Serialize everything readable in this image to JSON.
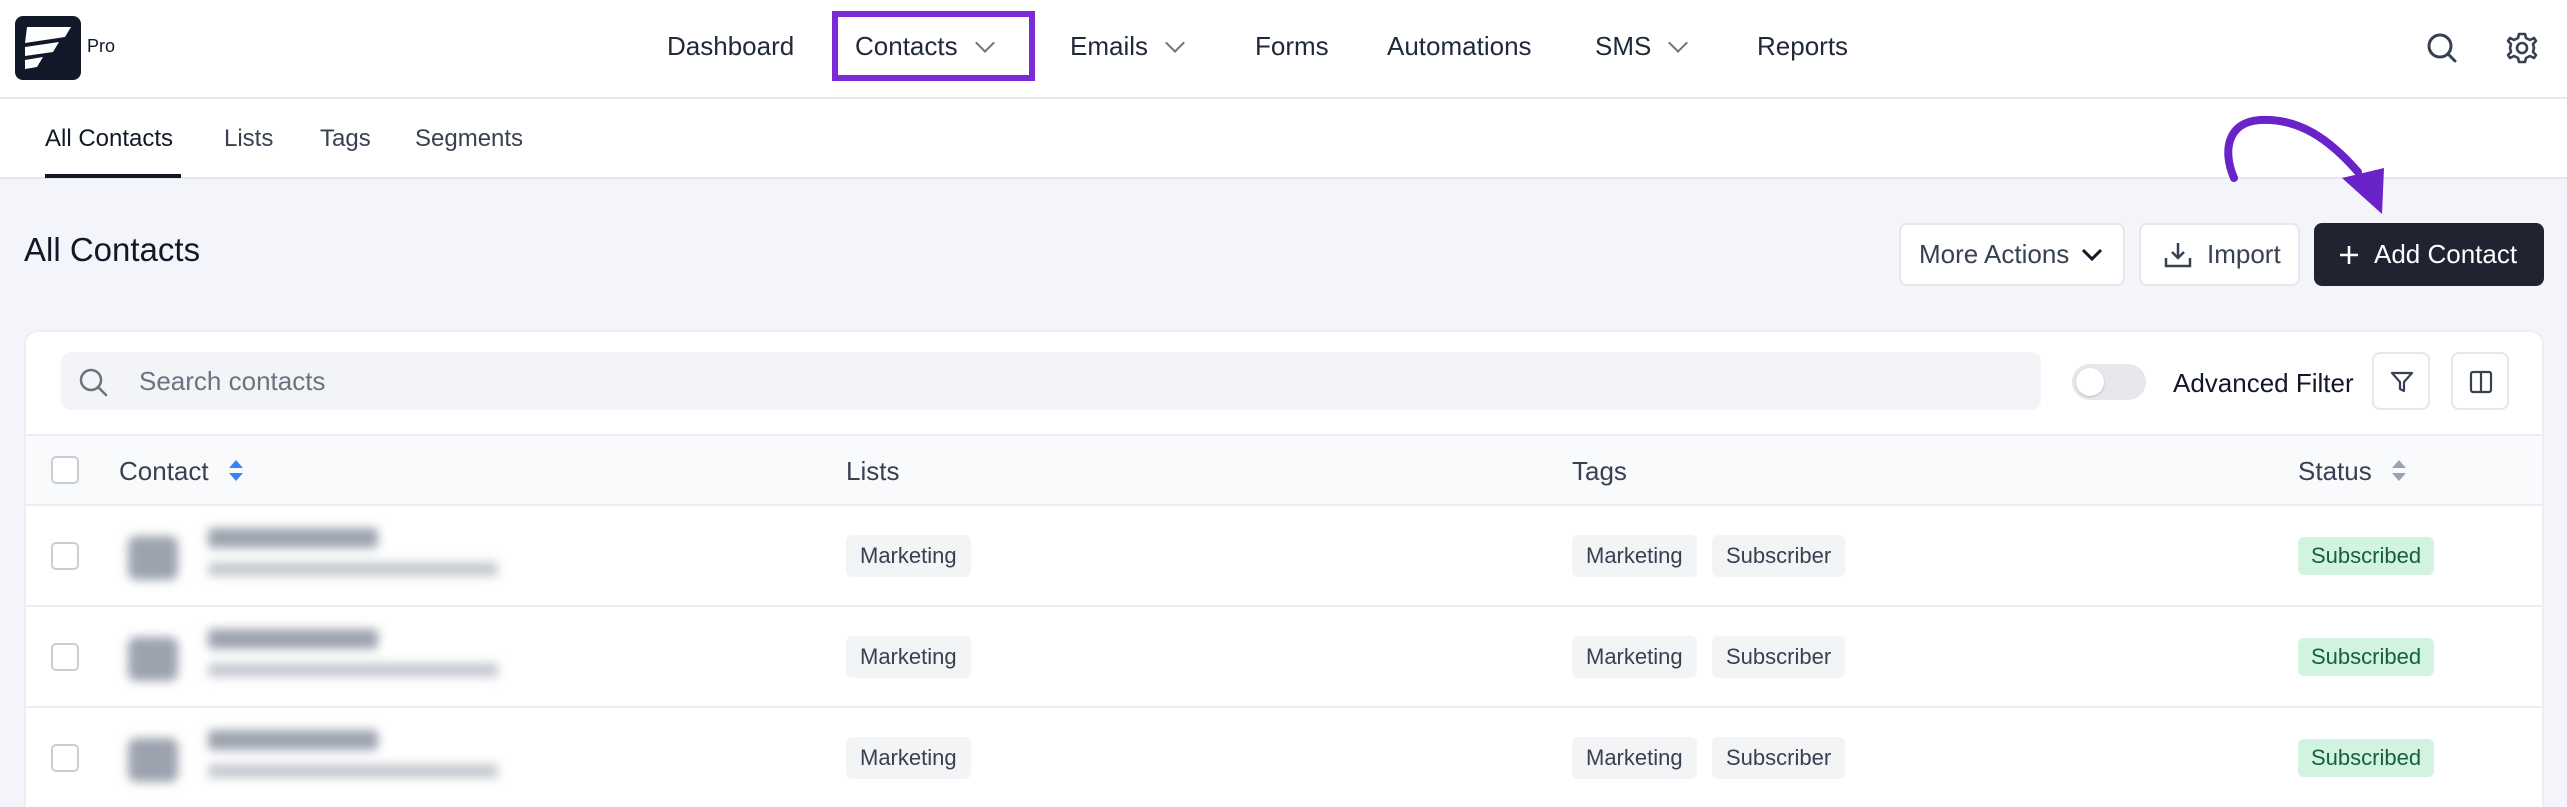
{
  "brand": {
    "pro_label": "Pro"
  },
  "nav": {
    "items": [
      {
        "label": "Dashboard"
      },
      {
        "label": "Contacts"
      },
      {
        "label": "Emails"
      },
      {
        "label": "Forms"
      },
      {
        "label": "Automations"
      },
      {
        "label": "SMS"
      },
      {
        "label": "Reports"
      }
    ],
    "active": "Contacts"
  },
  "subnav": {
    "tabs": [
      {
        "label": "All Contacts"
      },
      {
        "label": "Lists"
      },
      {
        "label": "Tags"
      },
      {
        "label": "Segments"
      }
    ],
    "active": "All Contacts"
  },
  "page": {
    "title": "All Contacts",
    "more_actions_label": "More Actions",
    "import_label": "Import",
    "add_contact_label": "Add Contact"
  },
  "toolbar": {
    "search_placeholder": "Search contacts",
    "advanced_filter_label": "Advanced Filter",
    "advanced_filter_enabled": false
  },
  "table": {
    "columns": [
      {
        "label": "Contact"
      },
      {
        "label": "Lists"
      },
      {
        "label": "Tags"
      },
      {
        "label": "Status"
      }
    ],
    "rows": [
      {
        "lists": [
          "Marketing"
        ],
        "tags": [
          "Marketing",
          "Subscriber"
        ],
        "status": "Subscribed"
      },
      {
        "lists": [
          "Marketing"
        ],
        "tags": [
          "Marketing",
          "Subscriber"
        ],
        "status": "Subscribed"
      },
      {
        "lists": [
          "Marketing"
        ],
        "tags": [
          "Marketing",
          "Subscriber"
        ],
        "status": "Subscribed"
      }
    ]
  },
  "colors": {
    "highlight": "#7a2bd6",
    "primary_button": "#1f2430",
    "status_bg": "#d1f3df",
    "status_text": "#15613a",
    "sort_active": "#3b82f6"
  }
}
